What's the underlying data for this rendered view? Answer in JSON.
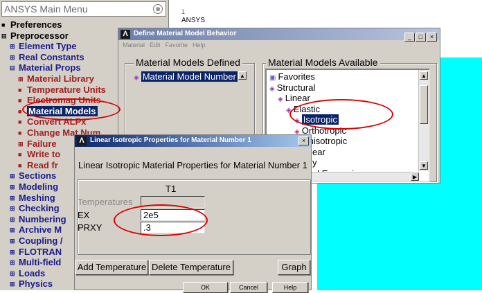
{
  "main_menu": {
    "title": "ANSYS Main Menu",
    "collapse_glyph": "⊗",
    "items": [
      {
        "label": "Preferences",
        "box": "■",
        "color": "black"
      },
      {
        "label": "Preprocessor",
        "box": "⊟",
        "color": "black"
      },
      {
        "label": "Element Type",
        "box": "⊞",
        "color": "blue"
      },
      {
        "label": "Real Constants",
        "box": "⊞",
        "color": "blue"
      },
      {
        "label": "Material Props",
        "box": "⊟",
        "color": "blue"
      },
      {
        "label": "Material Library",
        "box": "⊞",
        "color": "red"
      },
      {
        "label": "Temperature Units",
        "box": "■",
        "color": "red"
      },
      {
        "label": "Electromag Units",
        "box": "■",
        "color": "red"
      },
      {
        "label": "Material Models",
        "box": "■",
        "color": "red",
        "selected": true
      },
      {
        "label": "Convert ALPx",
        "box": "■",
        "color": "red"
      },
      {
        "label": "Change Mat Num",
        "box": "■",
        "color": "red"
      },
      {
        "label": "Failure",
        "box": "⊞",
        "color": "red"
      },
      {
        "label": "Write to",
        "box": "■",
        "color": "red"
      },
      {
        "label": "Read fr",
        "box": "■",
        "color": "red"
      },
      {
        "label": "Sections",
        "box": "⊞",
        "color": "blue"
      },
      {
        "label": "Modeling",
        "box": "⊞",
        "color": "blue"
      },
      {
        "label": "Meshing",
        "box": "⊞",
        "color": "blue"
      },
      {
        "label": "Checking",
        "box": "⊞",
        "color": "blue"
      },
      {
        "label": "Numbering",
        "box": "⊞",
        "color": "blue"
      },
      {
        "label": "Archive M",
        "box": "⊞",
        "color": "blue"
      },
      {
        "label": "Coupling /",
        "box": "⊞",
        "color": "blue"
      },
      {
        "label": "FLOTRAN",
        "box": "⊞",
        "color": "blue"
      },
      {
        "label": "Multi-field",
        "box": "⊞",
        "color": "blue"
      },
      {
        "label": "Loads",
        "box": "⊞",
        "color": "blue"
      },
      {
        "label": "Physics",
        "box": "⊞",
        "color": "blue"
      }
    ]
  },
  "graphics": {
    "line_number": "1",
    "ansys_text": "ANSYS"
  },
  "define_material": {
    "logo": "Λ",
    "title": "Define Material Model Behavior",
    "menubar": [
      "Material",
      "Edit",
      "Favorite",
      "Help"
    ],
    "defined_label": "Material Models Defined",
    "defined_item": "Material Model Number",
    "available_label": "Material Models Available",
    "tree": [
      {
        "label": "Favorites",
        "icon": "▣",
        "selected": false
      },
      {
        "label": "Structural",
        "icon": "◈",
        "selected": false
      },
      {
        "label": "Linear",
        "icon": "◈",
        "selected": false
      },
      {
        "label": "Elastic",
        "icon": "◈",
        "selected": false
      },
      {
        "label": "Isotropic",
        "icon": "◈",
        "selected": true
      },
      {
        "label": "Orthotropic",
        "icon": "◈",
        "selected": false
      },
      {
        "label": "Anisotropic",
        "icon": "",
        "selected": false
      },
      {
        "label": "ear",
        "icon": "",
        "selected": false
      },
      {
        "label": "y",
        "icon": "",
        "selected": false
      },
      {
        "label": "al Expansion",
        "icon": "",
        "selected": false
      }
    ],
    "window_buttons": [
      "_",
      "□",
      "×"
    ]
  },
  "linear_isotropic": {
    "logo": "Λ",
    "title": "Linear Isotropic Properties for Material Number 1",
    "close_glyph": "×",
    "heading": "Linear Isotropic Material Properties for Material Number 1",
    "column_header": "T1",
    "temperatures_label": "Temperatures",
    "rows": [
      {
        "label": "EX",
        "value": "2e5"
      },
      {
        "label": "PRXY",
        "value": ".3"
      }
    ],
    "buttons": {
      "add_temperature": "Add Temperature",
      "delete_temperature": "Delete Temperature",
      "graph": "Graph",
      "ok": "OK",
      "cancel": "Cancel",
      "help": "Help"
    }
  },
  "colors": {
    "graphics_background": "#00ffff",
    "annotation_red": "#e00000",
    "selection_blue": "#0a246a"
  }
}
